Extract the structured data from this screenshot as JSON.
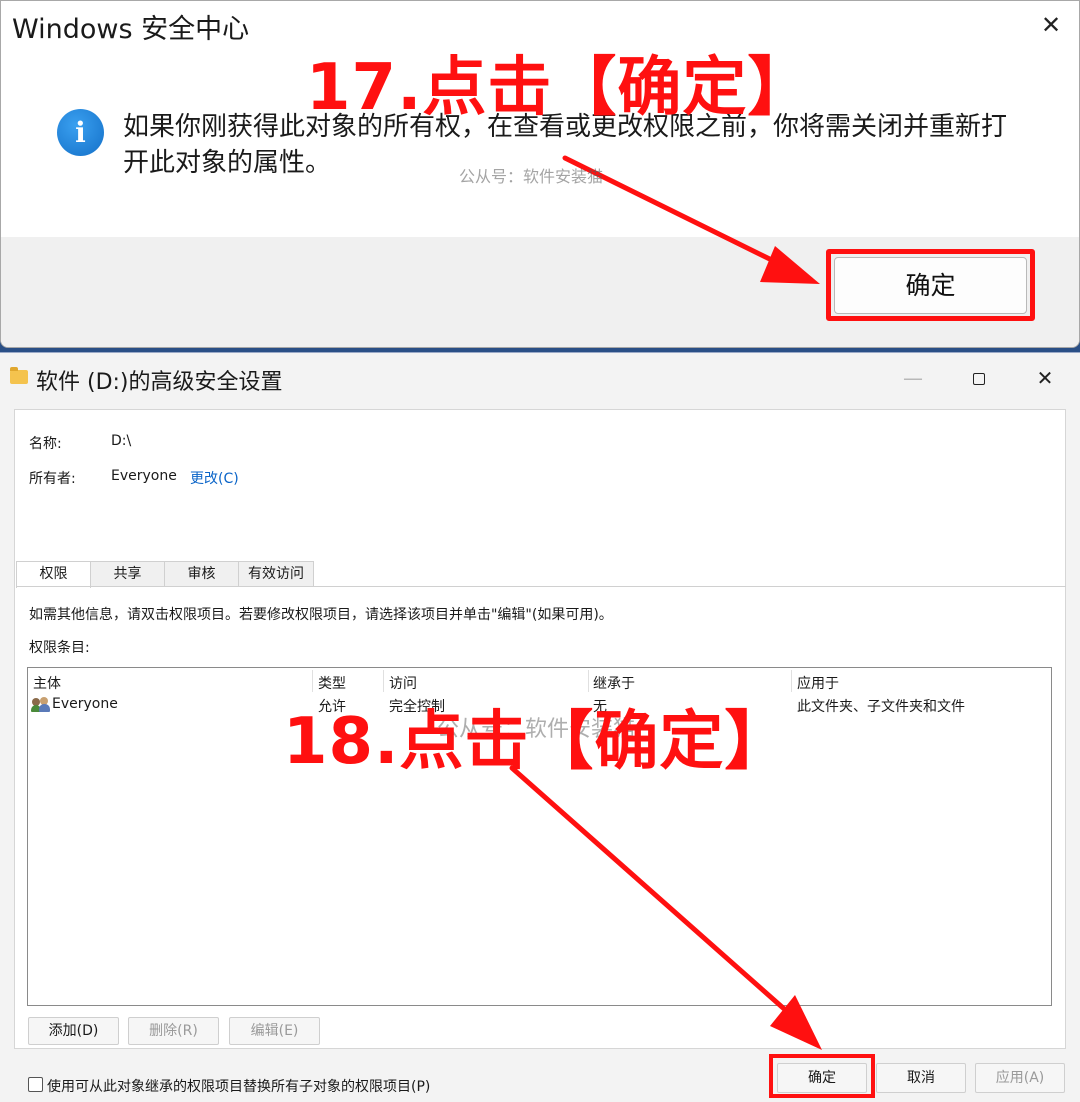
{
  "security_dialog": {
    "title": "Windows 安全中心",
    "close_glyph": "✕",
    "info_glyph": "i",
    "message": "如果你刚获得此对象的所有权，在查看或更改权限之前，你将需关闭并重新打开此对象的属性。",
    "ok_label": "确定"
  },
  "advanced_window": {
    "title": "软件 (D:)的高级安全设置",
    "controls": {
      "minimize": "—",
      "close": "✕"
    },
    "name_label": "名称:",
    "name_value": "D:\\",
    "owner_label": "所有者:",
    "owner_value": "Everyone",
    "change_link": "更改(C)",
    "tabs": [
      {
        "label": "权限"
      },
      {
        "label": "共享"
      },
      {
        "label": "审核"
      },
      {
        "label": "有效访问"
      }
    ],
    "instructions": "如需其他信息，请双击权限项目。若要修改权限项目，请选择该项目并单击\"编辑\"(如果可用)。",
    "entries_label": "权限条目:",
    "columns": [
      "主体",
      "类型",
      "访问",
      "继承于",
      "应用于"
    ],
    "rows": [
      {
        "principal": "Everyone",
        "type": "允许",
        "access": "完全控制",
        "inherited_from": "无",
        "applies_to": "此文件夹、子文件夹和文件"
      }
    ],
    "add_button": "添加(D)",
    "remove_button": "删除(R)",
    "edit_button": "编辑(E)",
    "replace_checkbox_label": "使用可从此对象继承的权限项目替换所有子对象的权限项目(P)",
    "ok_button": "确定",
    "cancel_button": "取消",
    "apply_button": "应用(A)"
  },
  "annotations": {
    "step17": "17.点击【确定】",
    "step18": "18.点击【确定】",
    "watermark": "公从号：软件安装猫",
    "highlight_color": "#ff1010"
  }
}
